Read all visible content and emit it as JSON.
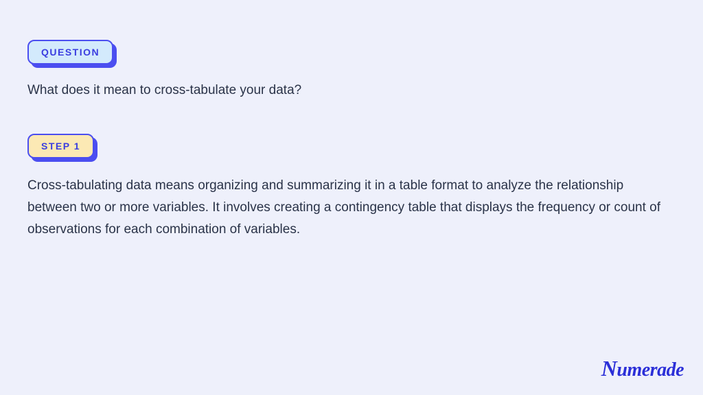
{
  "question": {
    "badge_label": "QUESTION",
    "text": "What does it mean to cross-tabulate your data?"
  },
  "step": {
    "badge_label": "STEP 1",
    "text": "Cross-tabulating data means organizing and summarizing it in a table format to analyze the relationship between two or more variables. It involves creating a contingency table that displays the frequency or count of observations for each combination of variables."
  },
  "brand": {
    "name": "Numerade"
  }
}
